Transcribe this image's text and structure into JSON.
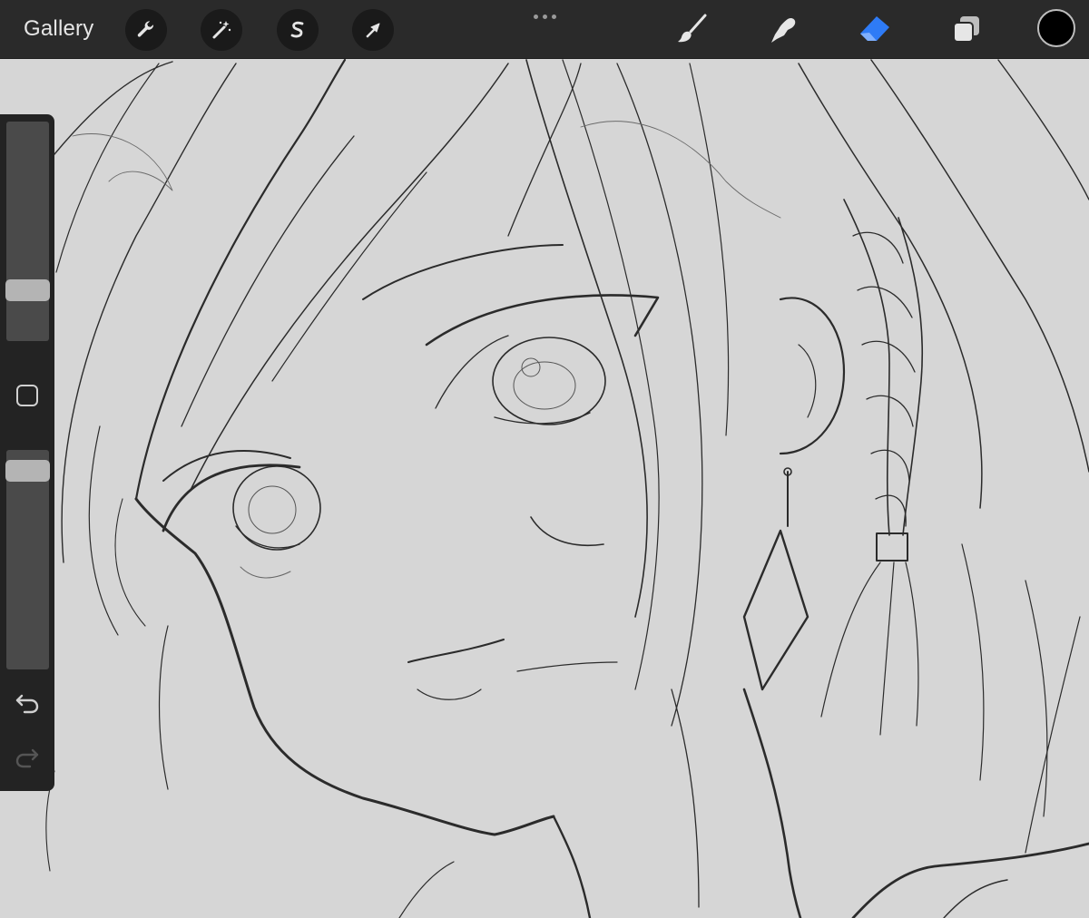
{
  "topbar": {
    "gallery_label": "Gallery",
    "actions": [
      {
        "name": "actions-wrench",
        "icon": "wrench-icon"
      },
      {
        "name": "adjustments-magic-wand",
        "icon": "magic-wand-icon"
      },
      {
        "name": "selection",
        "icon": "selection-s-icon"
      },
      {
        "name": "transform",
        "icon": "transform-arrow-icon"
      }
    ],
    "more_icon": "more-dots-icon",
    "tools": [
      {
        "name": "brush",
        "icon": "brush-icon",
        "active": false
      },
      {
        "name": "smudge",
        "icon": "smudge-finger-icon",
        "active": false
      },
      {
        "name": "eraser",
        "icon": "eraser-icon",
        "active": true
      },
      {
        "name": "layers",
        "icon": "layers-icon",
        "active": false
      }
    ],
    "current_color": "#000000"
  },
  "sidebar": {
    "brush_size_level": 0.2,
    "opacity_level": 0.95,
    "modify_icon": "square-modify-icon",
    "undo_icon": "undo-arrow-icon",
    "redo_icon": "redo-arrow-icon",
    "redo_enabled": false
  },
  "theme": {
    "toolbar_bg": "#2a2a2a",
    "canvas_bg": "#d6d6d6",
    "accent_active": "#2e7bf6",
    "icon_color": "#e6e6e6"
  },
  "canvas": {
    "content": "line-art-sketch-portrait"
  }
}
